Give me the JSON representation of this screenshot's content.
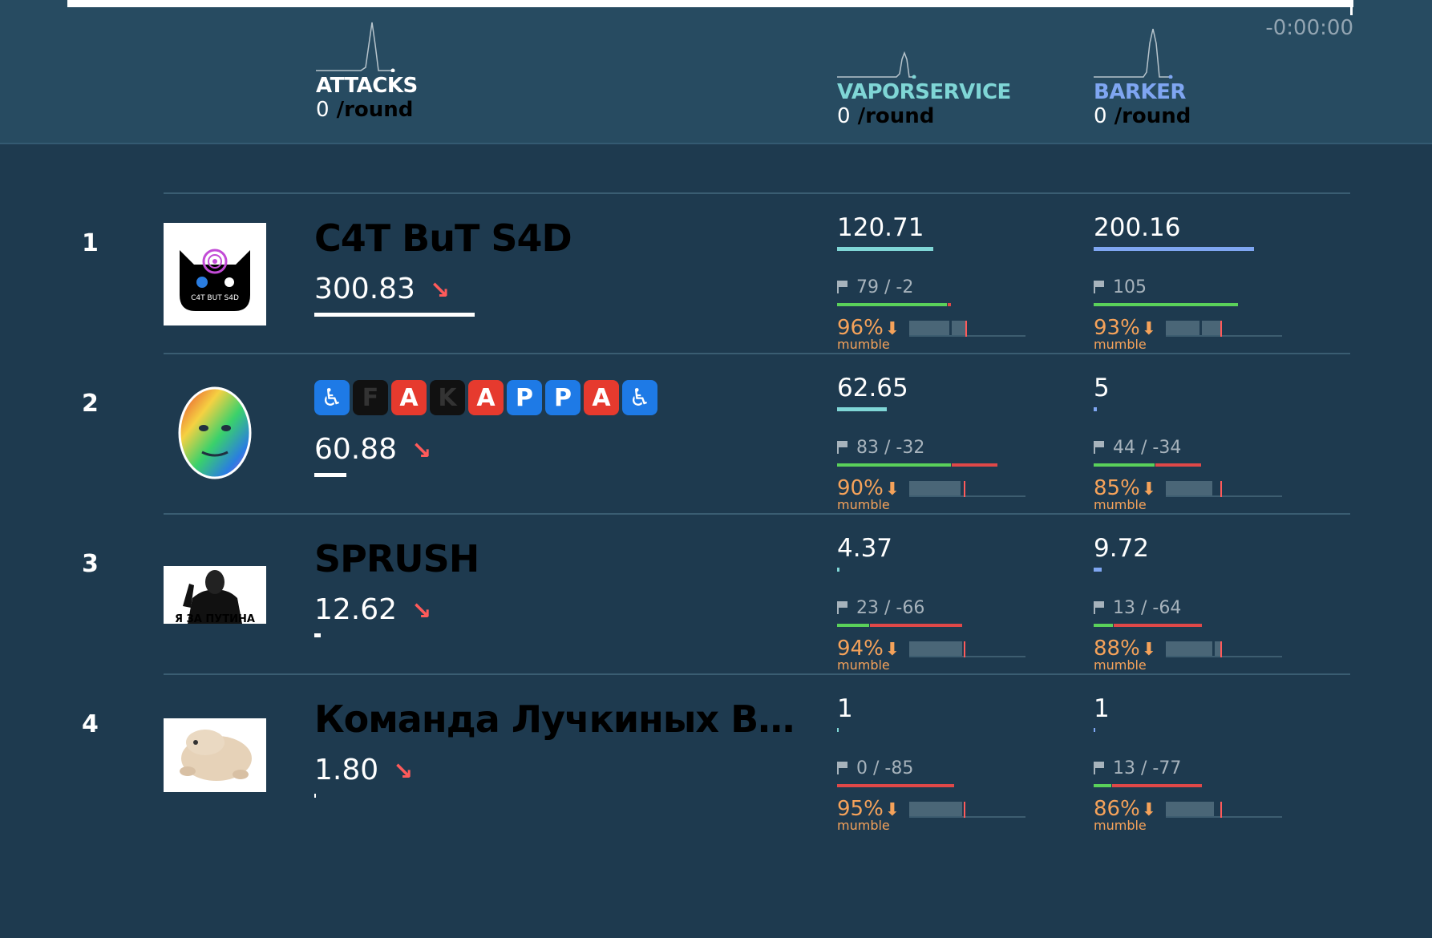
{
  "timer": "-0:00:00",
  "columns": {
    "attacks": {
      "title": "ATTACKS",
      "value": "0",
      "unit": "/round"
    },
    "services": [
      {
        "title": "VAPORSERVICE",
        "value": "0",
        "unit": "/round",
        "color": "#7fd6d6"
      },
      {
        "title": "BARKER",
        "value": "0",
        "unit": "/round",
        "color": "#7fa6f2"
      }
    ]
  },
  "colors": {
    "flag_pos": "#5ad15a",
    "flag_neg": "#e04848",
    "sla": "#f5a25a",
    "trend": "#ff5a5a"
  },
  "teams": [
    {
      "rank": "1",
      "name": "C4T BuT S4D",
      "score": "300.83",
      "trend": "↘",
      "score_fill": 0.75,
      "logo": "cat-logo",
      "logo_text": "C4T BUT S4D",
      "services": [
        {
          "points": "120.71",
          "points_fill": 0.55,
          "flags": "79 / -2",
          "pos_fill": 0.65,
          "neg_fill": 0.02,
          "sla": "96%",
          "sla_fill": 0.96,
          "status": "mumble"
        },
        {
          "points": "200.16",
          "points_fill": 0.92,
          "flags": "105",
          "pos_fill": 0.83,
          "neg_fill": 0.0,
          "sla": "93%",
          "sla_fill": 0.93,
          "status": "mumble"
        }
      ]
    },
    {
      "rank": "2",
      "name": "♿FAKAPPA♿",
      "name_letters": [
        "♿",
        "F",
        "A",
        "K",
        "A",
        "P",
        "P",
        "A",
        "♿"
      ],
      "score": "60.88",
      "trend": "↘",
      "score_fill": 0.15,
      "logo": "kappa-face",
      "services": [
        {
          "points": "62.65",
          "points_fill": 0.28,
          "flags": "83 / -32",
          "pos_fill": 0.65,
          "neg_fill": 0.27,
          "sla": "90%",
          "sla_fill": 0.9,
          "status": "mumble"
        },
        {
          "points": "5",
          "points_fill": 0.01,
          "flags": "44 / -34",
          "pos_fill": 0.35,
          "neg_fill": 0.27,
          "sla": "85%",
          "sla_fill": 0.85,
          "status": "mumble"
        }
      ]
    },
    {
      "rank": "3",
      "name": "SPRUSH",
      "score": "12.62",
      "trend": "↘",
      "score_fill": 0.03,
      "logo": "putin-poster",
      "logo_text": "Я ЗА ПУТИНА",
      "services": [
        {
          "points": "4.37",
          "points_fill": 0.01,
          "flags": "23 / -66",
          "pos_fill": 0.18,
          "neg_fill": 0.53,
          "sla": "94%",
          "sla_fill": 0.94,
          "status": "mumble"
        },
        {
          "points": "9.72",
          "points_fill": 0.04,
          "flags": "13 / -64",
          "pos_fill": 0.1,
          "neg_fill": 0.5,
          "sla": "88%",
          "sla_fill": 0.88,
          "status": "mumble"
        }
      ]
    },
    {
      "rank": "4",
      "name": "Команда Лучкиных Вяче…",
      "score": "1.80",
      "trend": "↘",
      "score_fill": 0.005,
      "logo": "frog-photo",
      "services": [
        {
          "points": "1",
          "points_fill": 0.005,
          "flags": "0 / -85",
          "pos_fill": 0.0,
          "neg_fill": 0.68,
          "sla": "95%",
          "sla_fill": 0.95,
          "status": "mumble"
        },
        {
          "points": "1",
          "points_fill": 0.005,
          "flags": "13 / -77",
          "pos_fill": 0.1,
          "neg_fill": 0.55,
          "sla": "86%",
          "sla_fill": 0.86,
          "status": "mumble"
        }
      ]
    }
  ]
}
